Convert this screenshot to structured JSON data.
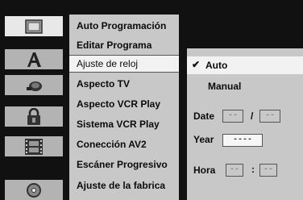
{
  "menu": {
    "items": [
      {
        "label": "Auto Programación"
      },
      {
        "label": "Editar Programa"
      },
      {
        "label": "Ajuste de reloj"
      },
      {
        "label": "Aspecto TV"
      },
      {
        "label": "Aspecto VCR Play"
      },
      {
        "label": "Sistema VCR Play"
      },
      {
        "label": "Conección AV2"
      },
      {
        "label": "Escáner Progresivo"
      },
      {
        "label": "Ajuste de la fabrica"
      }
    ],
    "selected_index": 2
  },
  "options": {
    "checkmark": "✔",
    "auto_label": "Auto",
    "manual_label": "Manual",
    "date_label": "Date",
    "date_day": "--",
    "date_sep": "/",
    "date_month": "--",
    "year_label": "Year",
    "year_value": "----",
    "hora_label": "Hora",
    "hora_hour": "--",
    "hora_sep": ":",
    "hora_min": "--"
  },
  "icons": [
    "setup-icon",
    "language-icon",
    "audio-icon",
    "lock-icon",
    "film-icon",
    "disc-icon"
  ]
}
